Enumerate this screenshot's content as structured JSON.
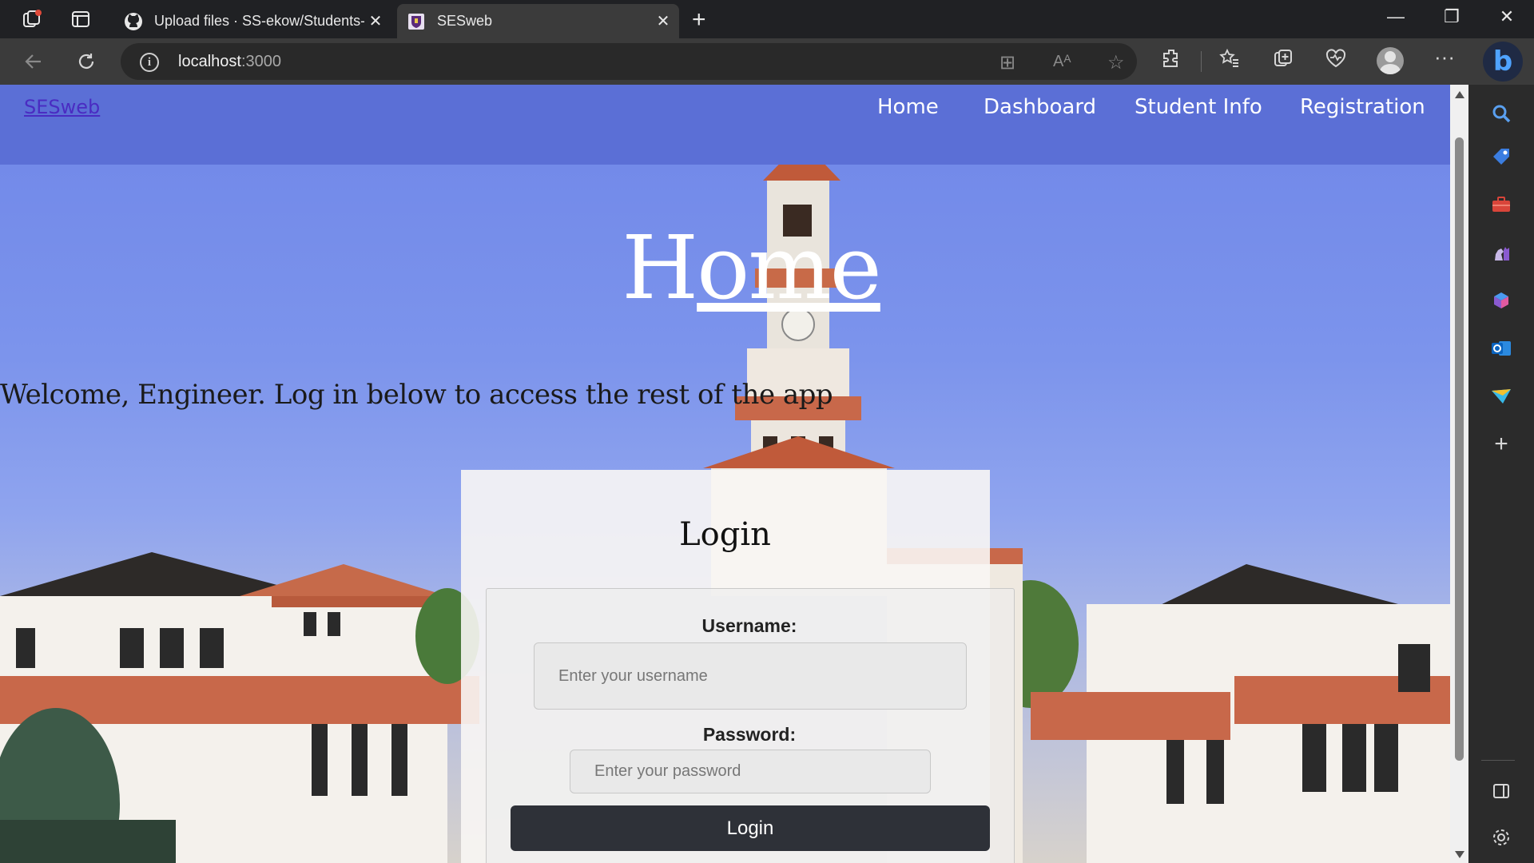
{
  "browser": {
    "tabs": [
      {
        "title": "Upload files · SS-ekow/Students-",
        "active": false,
        "icon": "github-icon"
      },
      {
        "title": "SESweb",
        "active": true,
        "icon": "university-crest-icon"
      }
    ],
    "address": {
      "host": "localhost",
      "port": ":3000"
    }
  },
  "site": {
    "brand": "SESweb",
    "nav": [
      "Home",
      "Dashboard",
      "Student Info",
      "Registration"
    ]
  },
  "page": {
    "heading_first": "H",
    "heading_rest": "ome",
    "welcome": "Welcome, Engineer. Log in below to access the rest of the app",
    "login_title": "Login",
    "username_label": "Username:",
    "username_placeholder": "Enter your username",
    "password_label": "Password:",
    "password_placeholder": "Enter your password",
    "login_button": "Login"
  },
  "colors": {
    "navbar": "#5b6fd6",
    "brand_link": "#4a2cc2",
    "button": "#2e3138"
  }
}
